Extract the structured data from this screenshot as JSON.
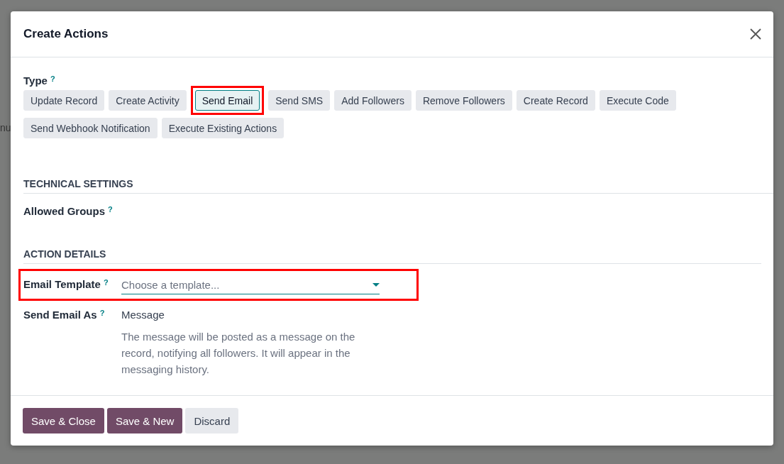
{
  "background": {
    "text_fragment": "nu"
  },
  "dialog": {
    "title": "Create Actions"
  },
  "type_field": {
    "label": "Type",
    "help": "?",
    "options": [
      {
        "label": "Update Record",
        "selected": false,
        "highlighted": false
      },
      {
        "label": "Create Activity",
        "selected": false,
        "highlighted": false
      },
      {
        "label": "Send Email",
        "selected": true,
        "highlighted": true
      },
      {
        "label": "Send SMS",
        "selected": false,
        "highlighted": false
      },
      {
        "label": "Add Followers",
        "selected": false,
        "highlighted": false
      },
      {
        "label": "Remove Followers",
        "selected": false,
        "highlighted": false
      },
      {
        "label": "Create Record",
        "selected": false,
        "highlighted": false
      },
      {
        "label": "Execute Code",
        "selected": false,
        "highlighted": false
      },
      {
        "label": "Send Webhook Notification",
        "selected": false,
        "highlighted": false
      },
      {
        "label": "Execute Existing Actions",
        "selected": false,
        "highlighted": false
      }
    ]
  },
  "technical_settings": {
    "heading": "TECHNICAL SETTINGS",
    "fields": [
      {
        "label": "Allowed Groups",
        "help": "?"
      }
    ]
  },
  "action_details": {
    "heading": "ACTION DETAILS",
    "email_template": {
      "label": "Email Template",
      "help": "?",
      "placeholder": "Choose a template...",
      "highlighted": true
    },
    "send_email_as": {
      "label": "Send Email As",
      "help": "?",
      "value": "Message",
      "description": "The message will be posted as a message on the record, notifying all followers. It will appear in the messaging history."
    }
  },
  "footer": {
    "buttons": [
      {
        "label": "Save & Close",
        "kind": "primary"
      },
      {
        "label": "Save & New",
        "kind": "primary"
      },
      {
        "label": "Discard",
        "kind": "secondary"
      }
    ]
  }
}
